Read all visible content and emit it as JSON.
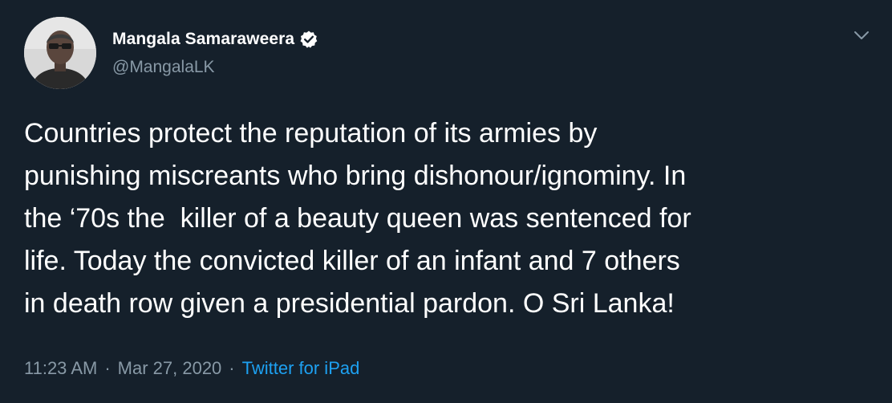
{
  "author": {
    "display_name": "Mangala Samaraweera",
    "handle": "@MangalaLK",
    "verified": true,
    "avatar_icon": "profile-photo"
  },
  "tweet": {
    "lines": [
      "Countries protect the reputation of its armies by",
      "punishing miscreants who bring dishonour/ignominy. In",
      "the ‘70s the  killer of a beauty queen was sentenced for",
      "life. Today the convicted killer of an infant and 7 others",
      "in death row given a presidential pardon. O Sri Lanka!"
    ]
  },
  "meta": {
    "time": "11:23 AM",
    "separator": "·",
    "date": "Mar 27, 2020",
    "source": "Twitter for iPad"
  },
  "colors": {
    "background": "#15202b",
    "text_primary": "#ffffff",
    "text_secondary": "#8899a6",
    "accent": "#1da1f2"
  },
  "icons": {
    "verified": "verified-badge-icon",
    "menu": "chevron-down-icon"
  }
}
